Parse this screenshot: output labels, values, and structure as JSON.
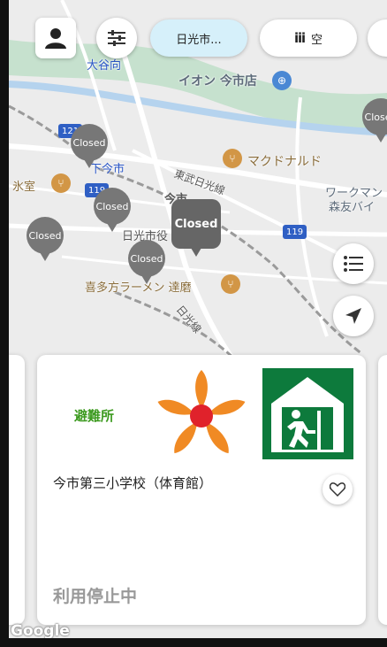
{
  "filter_pills": {
    "location": "日光市...",
    "vacancy": "空"
  },
  "map_labels": {
    "oyamukai": "大谷向",
    "aeon": "イオン 今市店",
    "mcdonalds": "マクドナルド",
    "shimoimaichi": "下今市",
    "himuro": "氷室",
    "tobu": "東武日光線",
    "imaichi": "今市",
    "nikkoshi": "日光市役",
    "workman": "ワークマン",
    "morotomo": "森友バイ",
    "ramen": "喜多方ラーメン 達磨",
    "nikkosen": "日光線",
    "route121": "121",
    "route119a": "119",
    "route119b": "119"
  },
  "pins": {
    "closed_label": "Closed"
  },
  "card": {
    "category": "避難所",
    "name": "今市第三小学校（体育館）",
    "status": "利用停止中"
  },
  "attribution": "Google",
  "colors": {
    "category_green": "#3c9a1f",
    "exit_green": "#0d7a3c",
    "emblem_orange": "#f08a24",
    "emblem_red": "#e0222b"
  }
}
